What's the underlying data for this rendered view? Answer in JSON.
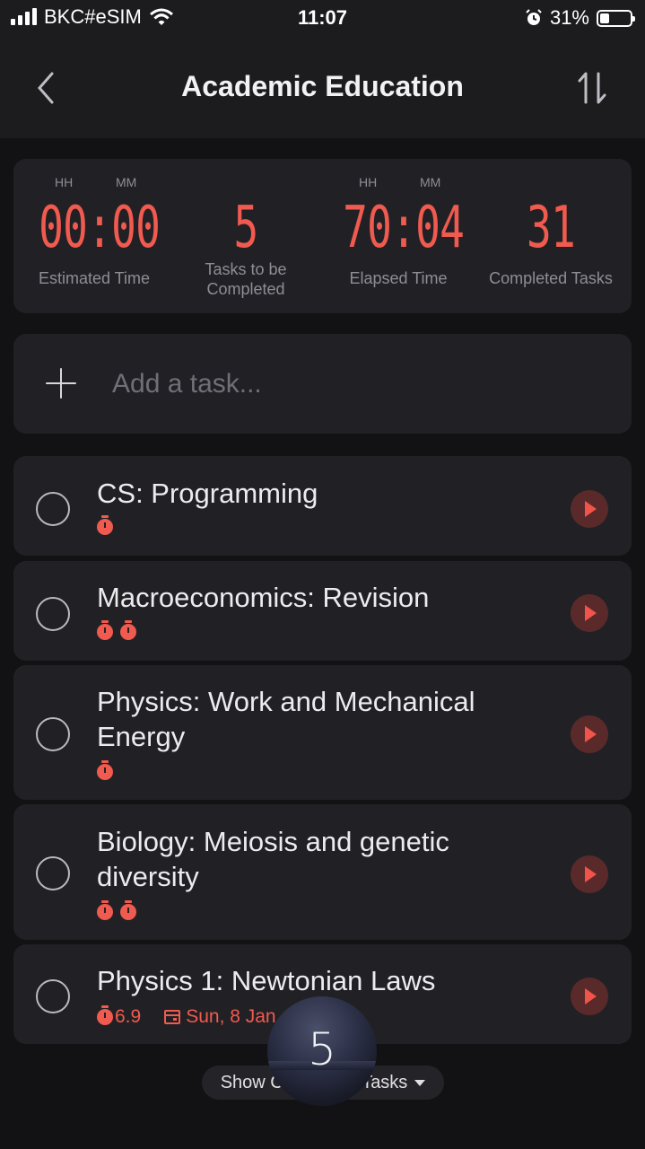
{
  "status_bar": {
    "carrier": "BKC#eSIM",
    "time": "11:07",
    "battery_percent": "31%",
    "battery_level": 0.31
  },
  "nav": {
    "title": "Academic Education"
  },
  "stats": [
    {
      "units_left": "HH",
      "units_right": "MM",
      "value": "00:00",
      "label": "Estimated Time"
    },
    {
      "units_left": "",
      "units_right": "",
      "value": "5",
      "label": "Tasks to be Completed"
    },
    {
      "units_left": "HH",
      "units_right": "MM",
      "value": "70:04",
      "label": "Elapsed Time"
    },
    {
      "units_left": "",
      "units_right": "",
      "value": "31",
      "label": "Completed Tasks"
    }
  ],
  "add_task": {
    "placeholder": "Add a task..."
  },
  "tasks": [
    {
      "title": "CS: Programming",
      "pomodoros": 1,
      "estimate": "",
      "due": ""
    },
    {
      "title": "Macroeconomics: Revision",
      "pomodoros": 2,
      "estimate": "",
      "due": ""
    },
    {
      "title": "Physics: Work and Mechanical Energy",
      "pomodoros": 1,
      "estimate": "",
      "due": ""
    },
    {
      "title": "Biology: Meiosis and genetic diversity",
      "pomodoros": 2,
      "estimate": "",
      "due": ""
    },
    {
      "title": "Physics 1: Newtonian Laws",
      "pomodoros": 1,
      "estimate": "6.9",
      "due": "Sun, 8 Jan"
    }
  ],
  "footer": {
    "show_completed_label": "Show Completed Tasks",
    "floating_timer_value": "5"
  },
  "colors": {
    "accent": "#f05a4f",
    "background": "#121214",
    "card": "#212125"
  }
}
